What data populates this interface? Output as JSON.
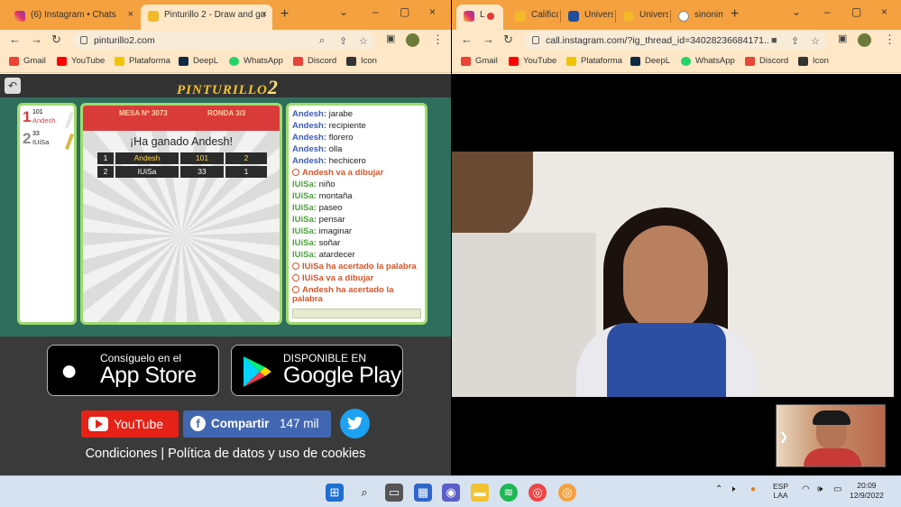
{
  "left_browser": {
    "tabs": [
      {
        "title": "(6) Instagram • Chats",
        "close": "×"
      },
      {
        "title": "Pinturillo 2 - Draw and gu",
        "close": "×"
      }
    ],
    "new_tab": "+",
    "window_controls": [
      "⌄",
      "–",
      "▢",
      "×"
    ],
    "url": "pinturillo2.com",
    "bookmarks": [
      "Gmail",
      "YouTube",
      "Plataforma",
      "DeepL",
      "WhatsApp",
      "Discord",
      "Icon"
    ]
  },
  "right_browser": {
    "tabs": [
      {
        "title": "L"
      },
      {
        "title": "Califica"
      },
      {
        "title": "Univers"
      },
      {
        "title": "Univers"
      },
      {
        "title": "sinonim"
      }
    ],
    "new_tab": "+",
    "window_controls": [
      "⌄",
      "–",
      "▢",
      "×"
    ],
    "url": "call.instagram.com/?ig_thread_id=34028236684171...",
    "bookmarks": [
      "Gmail",
      "YouTube",
      "Plataforma",
      "DeepL",
      "WhatsApp",
      "Discord",
      "Icon"
    ]
  },
  "game": {
    "logo_text": "PINTURILLO",
    "logo_num": "2",
    "back_icon": "↶",
    "players": [
      {
        "rank": "1",
        "points": "101",
        "name": "Andesh",
        "rank_color": "#d93b3b",
        "name_color": "#d93b3b"
      },
      {
        "rank": "2",
        "points": "33",
        "name": "IUiSa",
        "rank_color": "#888888",
        "name_color": "#333333"
      }
    ],
    "table_label": "MESA Nº 3073",
    "round_label": "RONDA 3/3",
    "winner_message": "¡Ha ganado Andesh!",
    "results": [
      {
        "pos": "1",
        "name": "Andesh",
        "score": "101",
        "wins": "2"
      },
      {
        "pos": "2",
        "name": "IUiSa",
        "score": "33",
        "wins": "1"
      }
    ],
    "chat": [
      {
        "user": "Andesh:",
        "text": "jarabe",
        "kind": "msg",
        "color": "#3b5bb5"
      },
      {
        "user": "Andesh:",
        "text": "recipiente",
        "kind": "msg",
        "color": "#3b5bb5"
      },
      {
        "user": "Andesh:",
        "text": "florero",
        "kind": "msg",
        "color": "#3b5bb5"
      },
      {
        "user": "Andesh:",
        "text": "olla",
        "kind": "msg",
        "color": "#3b5bb5"
      },
      {
        "user": "Andesh:",
        "text": "hechicero",
        "kind": "msg",
        "color": "#3b5bb5"
      },
      {
        "user": "",
        "text": "Andesh va a dibujar",
        "kind": "sys",
        "color": "#d5552a"
      },
      {
        "user": "IUiSa:",
        "text": "niño",
        "kind": "msg",
        "color": "#4aa13a"
      },
      {
        "user": "IUiSa:",
        "text": "montaña",
        "kind": "msg",
        "color": "#4aa13a"
      },
      {
        "user": "IUiSa:",
        "text": "paseo",
        "kind": "msg",
        "color": "#4aa13a"
      },
      {
        "user": "IUiSa:",
        "text": "pensar",
        "kind": "msg",
        "color": "#4aa13a"
      },
      {
        "user": "IUiSa:",
        "text": "imaginar",
        "kind": "msg",
        "color": "#4aa13a"
      },
      {
        "user": "IUiSa:",
        "text": "soñar",
        "kind": "msg",
        "color": "#4aa13a"
      },
      {
        "user": "IUiSa:",
        "text": "atardecer",
        "kind": "msg",
        "color": "#4aa13a"
      },
      {
        "user": "",
        "text": "IUiSa ha acertado la palabra",
        "kind": "sys",
        "color": "#d5552a"
      },
      {
        "user": "",
        "text": "IUiSa va a dibujar",
        "kind": "sys",
        "color": "#d5552a"
      },
      {
        "user": "",
        "text": "Andesh ha acertado la",
        "kind": "sys",
        "color": "#d5552a"
      },
      {
        "user": "",
        "text": "palabra",
        "kind": "sys-cont",
        "color": "#d5552a"
      }
    ],
    "appstore_small": "Consíguelo en el",
    "appstore_big": "App Store",
    "googleplay_small": "DISPONIBLE EN",
    "googleplay_big": "Google Play",
    "youtube_label": "YouTube",
    "share_label": "Compartir",
    "share_count": "147 mil",
    "twitter_icon": "twitter-bird",
    "footer_text": "Condiciones | Política de datos y uso de cookies"
  },
  "taskbar": {
    "lang1": "ESP",
    "lang2": "LAA",
    "time": "20:09",
    "date": "12/9/2022"
  }
}
